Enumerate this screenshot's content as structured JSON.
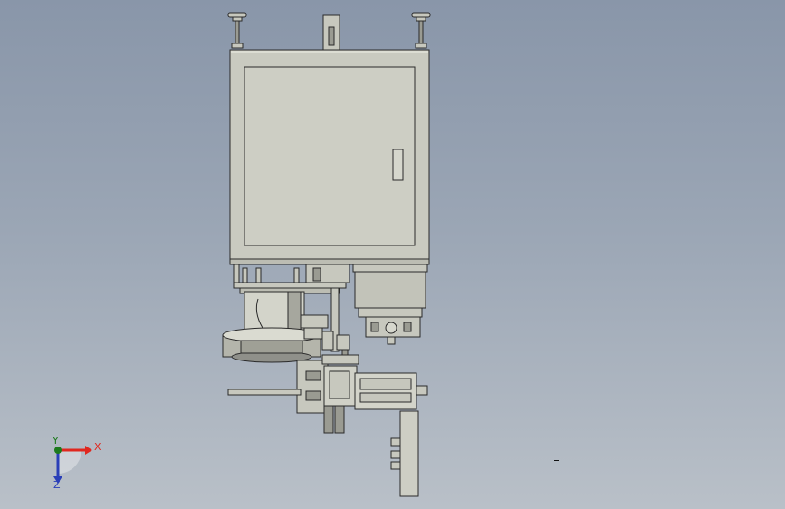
{
  "colors": {
    "part_fill": "#c7c8be",
    "part_light": "#d6d7cd",
    "part_dark": "#9a9b92",
    "edge": "#2a2a2a",
    "axis_x": "#e0271e",
    "axis_y": "#1d7a1d",
    "axis_z": "#2a3fb8"
  },
  "triad": {
    "x_label": "X",
    "y_label": "Y",
    "z_label": "Z"
  }
}
